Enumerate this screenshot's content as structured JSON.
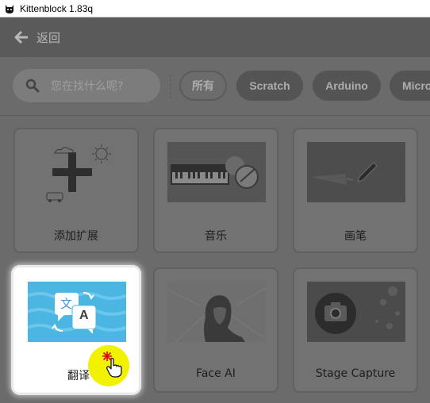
{
  "window": {
    "title": "Kittenblock 1.83q"
  },
  "nav": {
    "back_label": "返回"
  },
  "search": {
    "placeholder": "您在找什么呢?"
  },
  "filters": [
    {
      "label": "所有",
      "active": true
    },
    {
      "label": "Scratch",
      "active": false
    },
    {
      "label": "Arduino",
      "active": false
    },
    {
      "label": "Micro",
      "active": false
    }
  ],
  "extensions": [
    {
      "label": "添加扩展"
    },
    {
      "label": "音乐"
    },
    {
      "label": "画笔"
    },
    {
      "label": "翻译"
    },
    {
      "label": "Face AI"
    },
    {
      "label": "Stage Capture"
    }
  ],
  "translate_thumb": {
    "glyph_zh": "文",
    "glyph_en": "A"
  }
}
